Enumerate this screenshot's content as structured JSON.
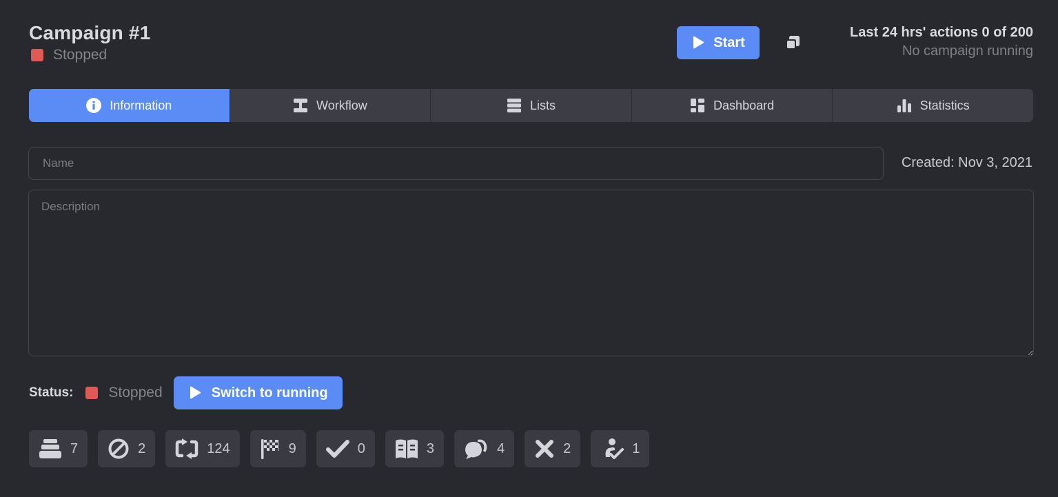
{
  "campaign": {
    "title": "Campaign #1",
    "state": "Stopped",
    "state_color": "#e05a55"
  },
  "header": {
    "start_label": "Start",
    "actions_summary": "Last 24 hrs' actions 0 of 200",
    "running_status": "No campaign running"
  },
  "tabs": [
    {
      "label": "Information",
      "icon": "info-icon",
      "active": true
    },
    {
      "label": "Workflow",
      "icon": "workflow-icon",
      "active": false
    },
    {
      "label": "Lists",
      "icon": "list-icon",
      "active": false
    },
    {
      "label": "Dashboard",
      "icon": "dashboard-icon",
      "active": false
    },
    {
      "label": "Statistics",
      "icon": "bar-chart-icon",
      "active": false
    }
  ],
  "form": {
    "name_value": "",
    "name_placeholder": "Name",
    "created": "Created: Nov 3, 2021",
    "description_value": "",
    "description_placeholder": "Description"
  },
  "status": {
    "label": "Status:",
    "value": "Stopped",
    "switch_label": "Switch to running"
  },
  "badges": [
    {
      "icon": "stack-icon",
      "count": "7"
    },
    {
      "icon": "ban-icon",
      "count": "2"
    },
    {
      "icon": "sync-icon",
      "count": "124"
    },
    {
      "icon": "checkered-flag-icon",
      "count": "9"
    },
    {
      "icon": "check-icon",
      "count": "0"
    },
    {
      "icon": "book-open-icon",
      "count": "3"
    },
    {
      "icon": "chat-wave-icon",
      "count": "4"
    },
    {
      "icon": "times-icon",
      "count": "2"
    },
    {
      "icon": "user-check-icon",
      "count": "1"
    }
  ],
  "colors": {
    "accent": "#5b8cf6",
    "background": "#28292e",
    "tab_background": "#3d3e45",
    "badge_background": "#3a3b42",
    "stopped": "#e05a55"
  }
}
